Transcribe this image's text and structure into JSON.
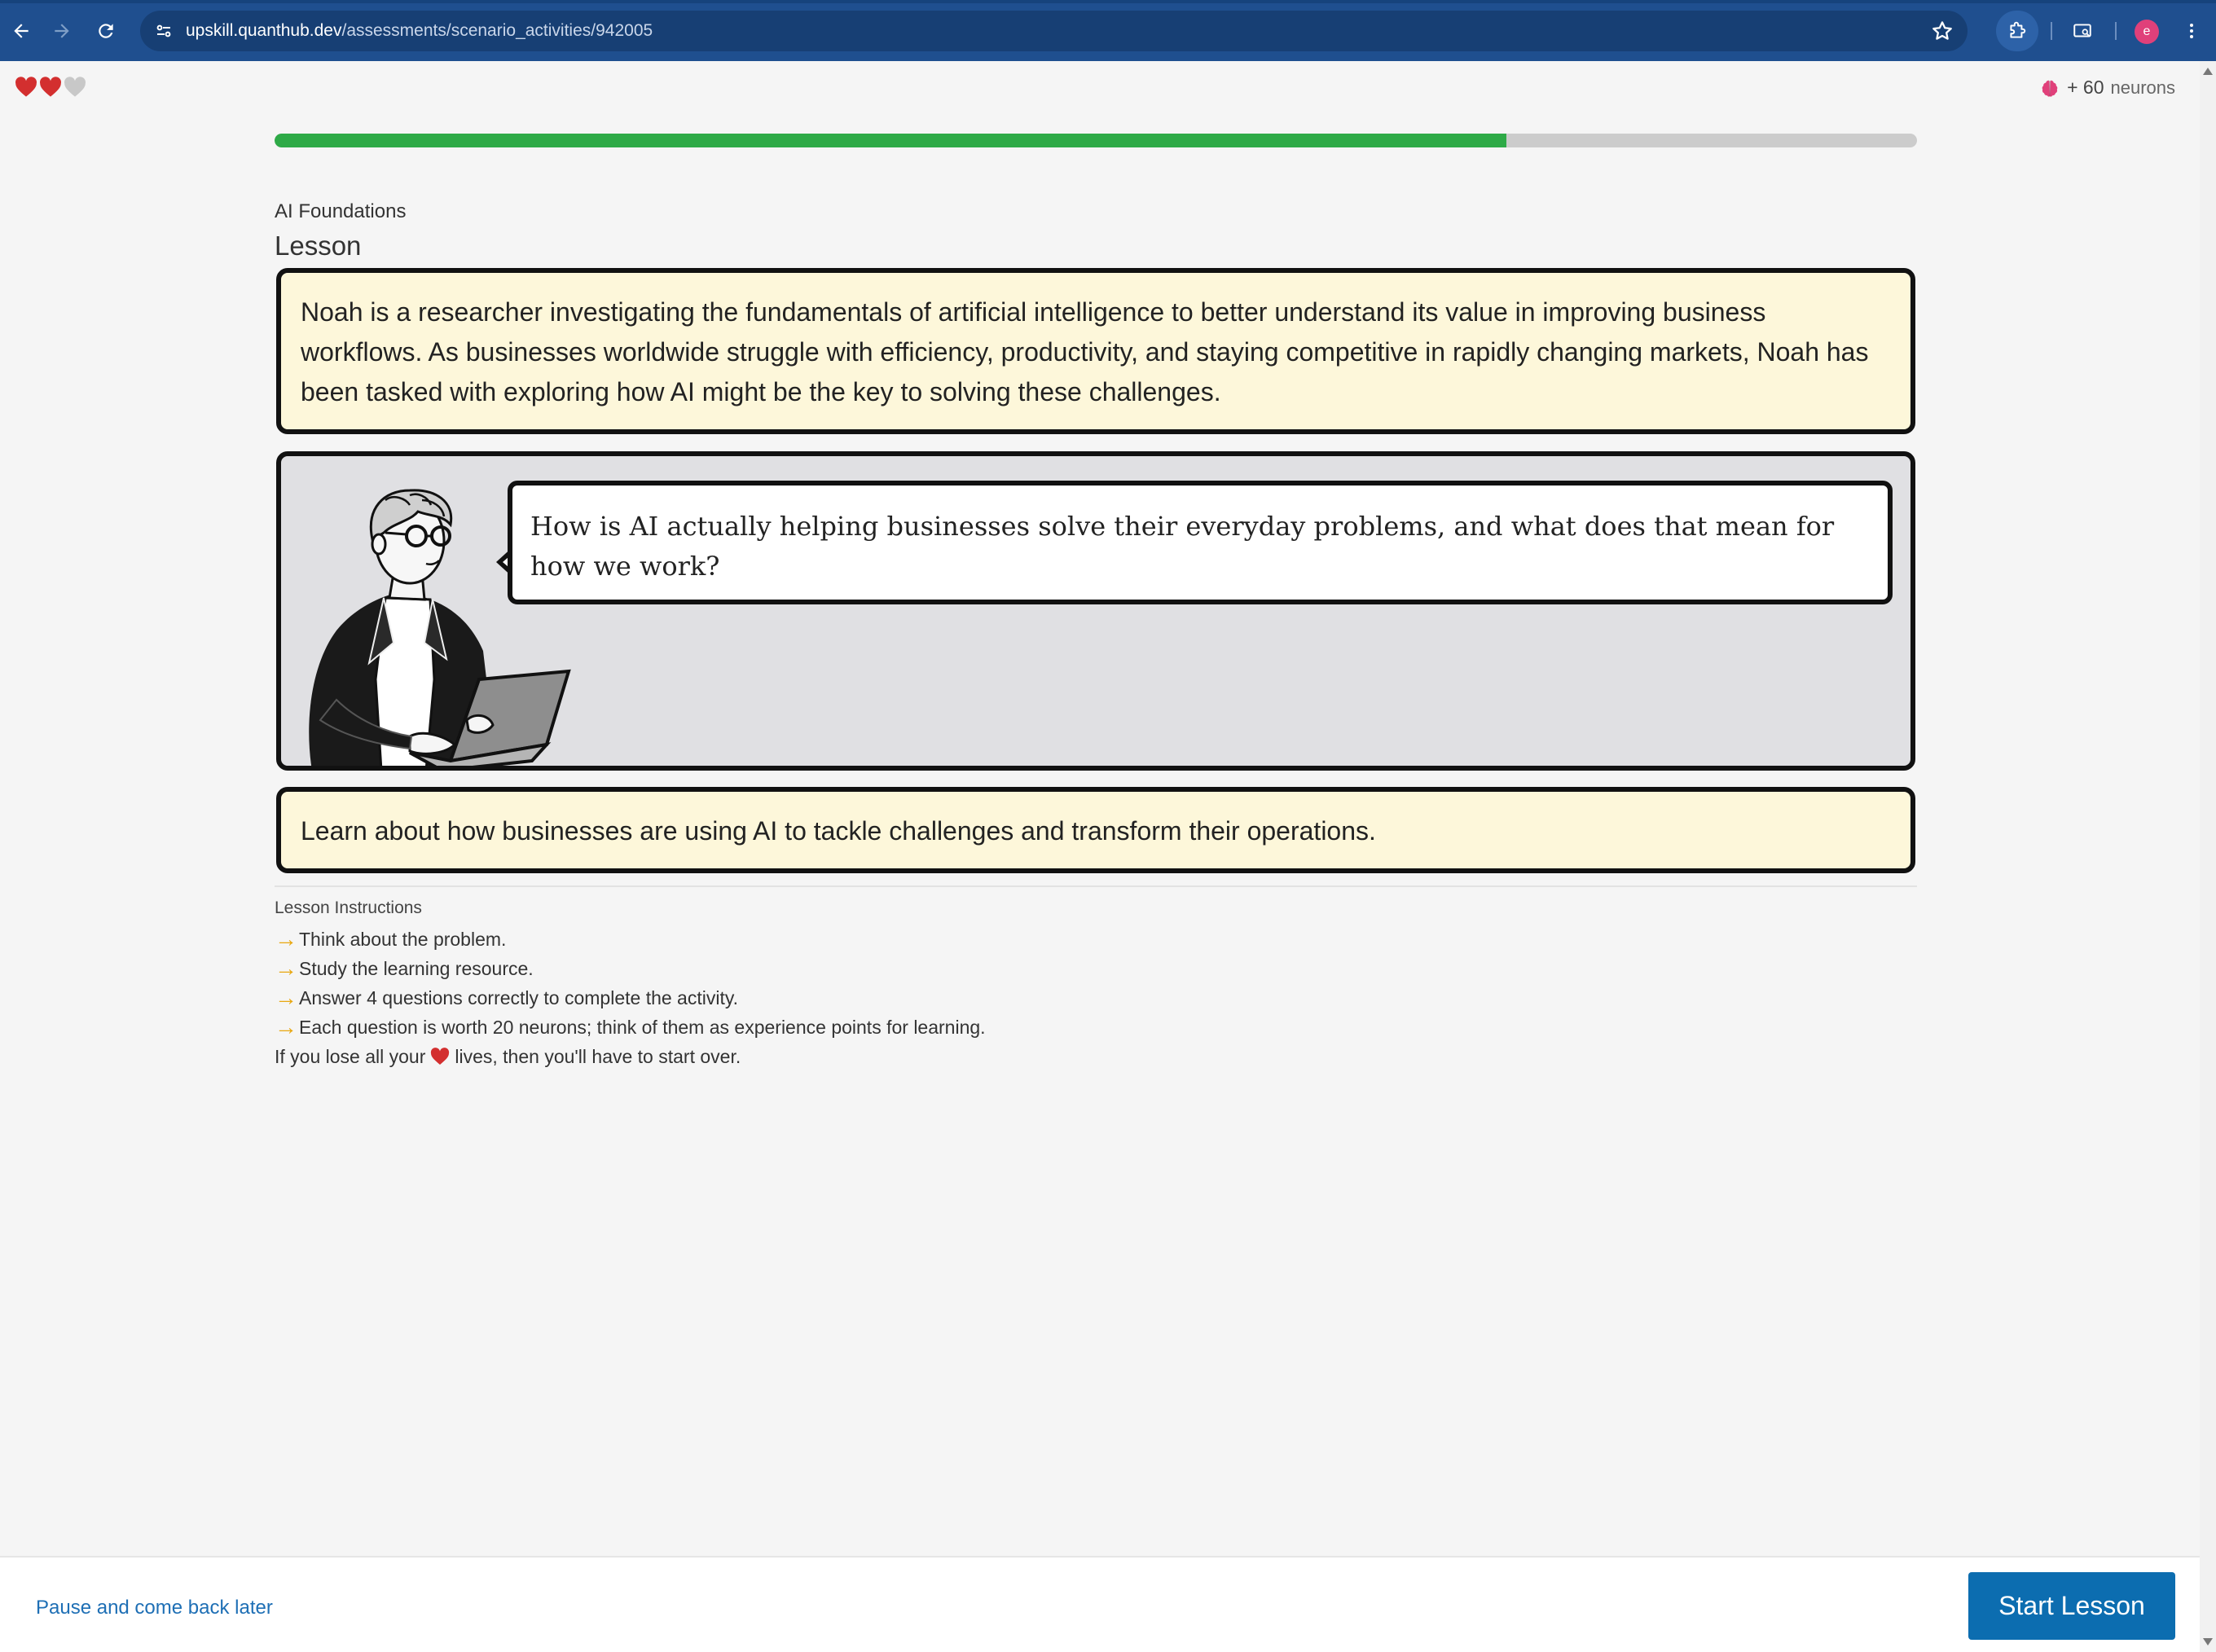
{
  "browser": {
    "url_host": "upskill.quanthub.dev",
    "url_path": "/assessments/scenario_activities/942005",
    "profile_initial": "e"
  },
  "header": {
    "hearts": [
      {
        "state": "filled",
        "color": "#d32f2f"
      },
      {
        "state": "filled",
        "color": "#d32f2f"
      },
      {
        "state": "empty",
        "color": "#c8c8c8"
      }
    ],
    "neurons_amount": "+ 60",
    "neurons_unit": "neurons",
    "progress_fraction": 0.75
  },
  "course": {
    "name": "AI Foundations",
    "section": "Lesson"
  },
  "scenario": {
    "intro": "Noah is a researcher investigating the fundamentals of artificial intelligence to better understand its value in improving business workflows. As businesses worldwide struggle with efficiency, productivity, and staying competitive in rapidly changing markets, Noah has been tasked with exploring how AI might be the key to solving these challenges.",
    "question": "How is AI actually helping businesses solve their everyday problems, and what does that mean for how we work?",
    "goal": "Learn about how businesses are using AI to tackle challenges and transform their operations."
  },
  "instructions": {
    "title": "Lesson Instructions",
    "items": [
      "Think about the problem.",
      "Study the learning resource.",
      "Answer 4 questions correctly to complete the activity.",
      "Each question is worth 20 neurons; think of them as experience points for learning."
    ],
    "note_before": "If you lose all your",
    "note_after": "lives, then you'll have to start over."
  },
  "footer": {
    "pause_label": "Pause and come back later",
    "start_label": "Start Lesson"
  },
  "colors": {
    "progress_fill": "#2eaa47",
    "accent_button": "#0c6db0",
    "arrow": "#e8a812",
    "browser_bar": "#1f4f8f"
  }
}
